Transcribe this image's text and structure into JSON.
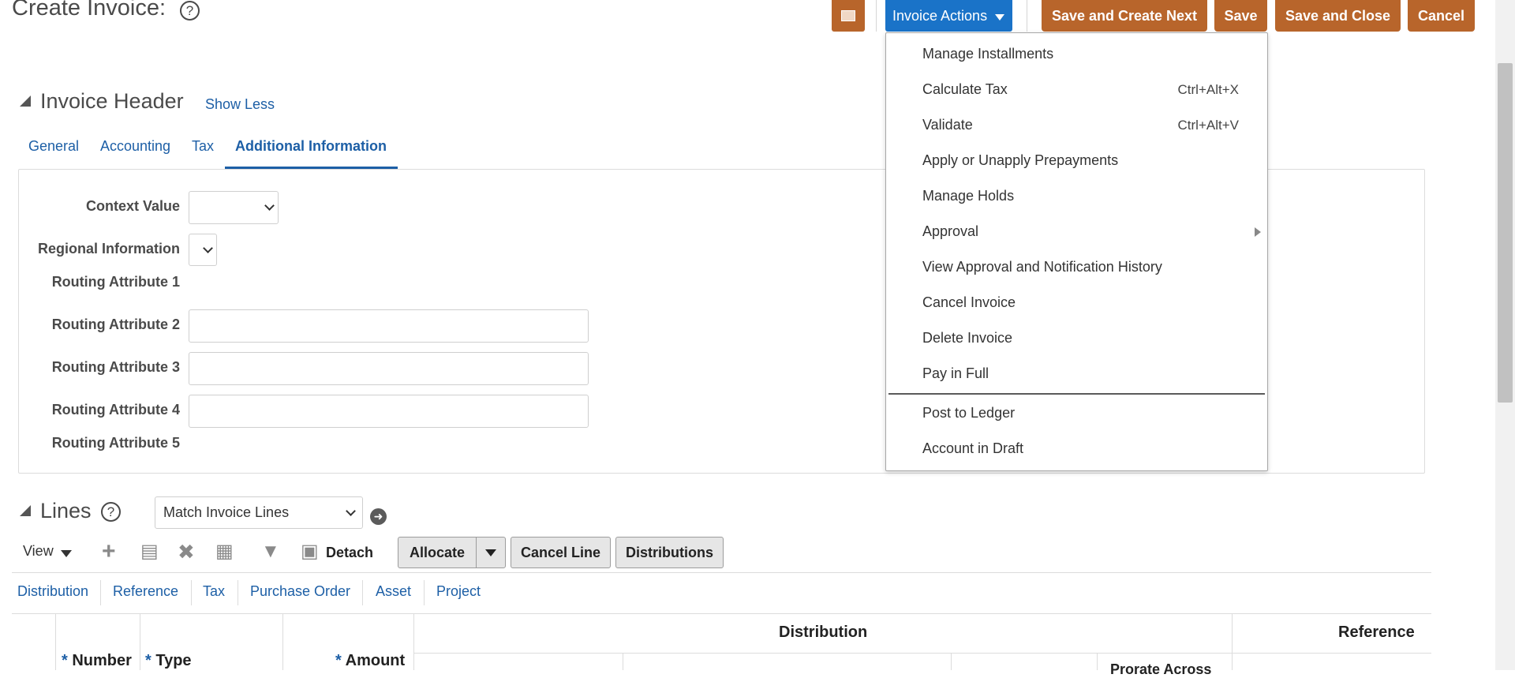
{
  "page": {
    "title": "Create Invoice:",
    "help_glyph": "?"
  },
  "toolbar": {
    "invoice_actions_label": "Invoice Actions",
    "save_create_next_label": "Save and Create Next",
    "save_label": "Save",
    "save_close_label": "Save and Close",
    "cancel_label": "Cancel"
  },
  "invoice_header": {
    "title": "Invoice Header",
    "show_less_label": "Show Less",
    "tabs": [
      {
        "label": "General"
      },
      {
        "label": "Accounting"
      },
      {
        "label": "Tax"
      },
      {
        "label": "Additional Information"
      }
    ],
    "fields": {
      "context_value": {
        "label": "Context Value",
        "value": ""
      },
      "regional_information": {
        "label": "Regional Information",
        "value": ""
      },
      "routing_attribute_1": {
        "label": "Routing Attribute 1"
      },
      "routing_attribute_2": {
        "label": "Routing Attribute 2",
        "value": ""
      },
      "routing_attribute_3": {
        "label": "Routing Attribute 3",
        "value": ""
      },
      "routing_attribute_4": {
        "label": "Routing Attribute 4",
        "value": ""
      },
      "routing_attribute_5": {
        "label": "Routing Attribute 5"
      }
    }
  },
  "lines": {
    "title": "Lines",
    "match_select_value": "Match Invoice Lines",
    "view_label": "View",
    "detach_label": "Detach",
    "allocate_label": "Allocate",
    "cancel_line_label": "Cancel Line",
    "distributions_label": "Distributions",
    "subtabs": [
      {
        "label": "Distribution"
      },
      {
        "label": "Reference"
      },
      {
        "label": "Tax"
      },
      {
        "label": "Purchase Order"
      },
      {
        "label": "Asset"
      },
      {
        "label": "Project"
      }
    ],
    "table": {
      "group_headers": {
        "distribution": "Distribution",
        "reference": "Reference"
      },
      "columns": {
        "number": "Number",
        "type": "Type",
        "amount": "Amount",
        "prorate_partial": "Prorate Across"
      },
      "required_mark": "*"
    }
  },
  "invoice_actions_menu": {
    "items": [
      {
        "label": "Manage Installments",
        "shortcut": ""
      },
      {
        "label": "Calculate Tax",
        "shortcut": "Ctrl+Alt+X"
      },
      {
        "label": "Validate",
        "shortcut": "Ctrl+Alt+V"
      },
      {
        "label": "Apply or Unapply Prepayments",
        "shortcut": ""
      },
      {
        "label": "Manage Holds",
        "shortcut": ""
      },
      {
        "label": "Approval",
        "shortcut": "",
        "has_submenu": true
      },
      {
        "label": "View Approval and Notification History",
        "shortcut": ""
      },
      {
        "label": "Cancel Invoice",
        "shortcut": ""
      },
      {
        "label": "Delete Invoice",
        "shortcut": ""
      },
      {
        "label": "Pay in Full",
        "shortcut": ""
      },
      {
        "label": "Post to Ledger",
        "shortcut": ""
      },
      {
        "label": "Account in Draft",
        "shortcut": ""
      }
    ]
  },
  "icons": {
    "help": "help-circle-icon",
    "header_shortcut": "document-panel-icon",
    "add": "plus-icon",
    "edit": "edit-icon",
    "delete": "x-icon",
    "freeze": "freeze-columns-icon",
    "query": "query-by-example-icon",
    "detach": "detach-icon",
    "go": "go-arrow-icon",
    "collapse": "collapse-triangle-icon"
  },
  "colors": {
    "primary_blue": "#1a73c8",
    "action_orange": "#b8652b",
    "link_blue": "#1d5fa6"
  }
}
